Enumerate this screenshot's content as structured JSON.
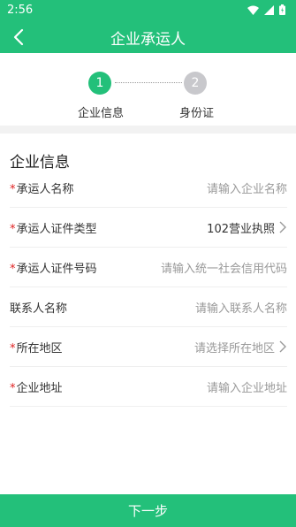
{
  "status_bar": {
    "time": "2:56"
  },
  "header": {
    "title": "企业承运人"
  },
  "steps": [
    {
      "number": "1",
      "label": "企业信息"
    },
    {
      "number": "2",
      "label": "身份证"
    }
  ],
  "section": {
    "title": "企业信息"
  },
  "form": {
    "required_mark": "*",
    "fields": [
      {
        "label": "承运人名称",
        "value": "请输入企业名称"
      },
      {
        "label": "承运人证件类型",
        "value": "102营业执照"
      },
      {
        "label": "承运人证件号码",
        "value": "请输入统一社会信用代码"
      },
      {
        "label": "联系人名称",
        "value": "请输入联系人名称"
      },
      {
        "label": "所在地区",
        "value": "请选择所在地区"
      },
      {
        "label": "企业地址",
        "value": "请输入企业地址"
      }
    ]
  },
  "footer": {
    "next_label": "下一步"
  },
  "colors": {
    "accent": "#23c07a",
    "inactive_step": "#c8c8cc",
    "required": "#e02020"
  },
  "icons": [
    "wifi-icon",
    "signal-icon",
    "battery-icon",
    "back-arrow-icon",
    "chevron-right-icon"
  ]
}
